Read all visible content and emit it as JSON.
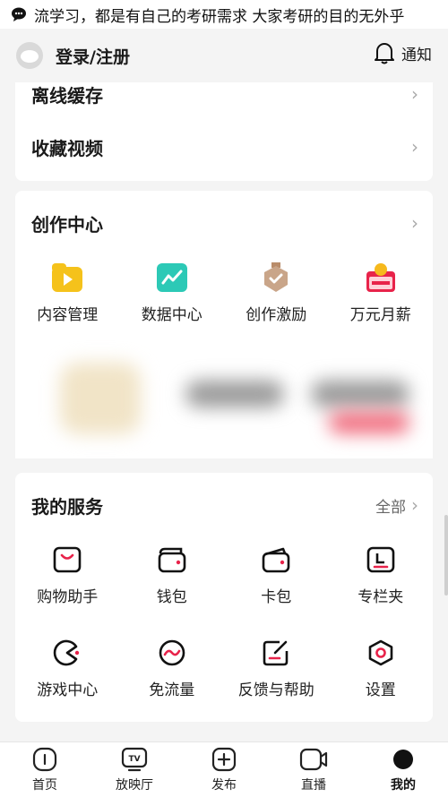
{
  "ticker": {
    "text": "流学习，都是有自己的考研需求 大家考研的目的无外乎"
  },
  "header": {
    "login_label": "登录/注册",
    "notify_label": "通知"
  },
  "top_card": {
    "items": [
      {
        "label": "离线缓存"
      },
      {
        "label": "收藏视频"
      }
    ]
  },
  "creator": {
    "title": "创作中心",
    "items": [
      {
        "label": "内容管理",
        "icon": "video-folder-icon"
      },
      {
        "label": "数据中心",
        "icon": "chart-line-icon"
      },
      {
        "label": "创作激励",
        "icon": "medal-icon"
      },
      {
        "label": "万元月薪",
        "icon": "calendar-coin-icon"
      }
    ]
  },
  "services": {
    "title": "我的服务",
    "all_label": "全部",
    "items": [
      {
        "label": "购物助手",
        "icon": "shopping-bag-icon"
      },
      {
        "label": "钱包",
        "icon": "wallet-icon"
      },
      {
        "label": "卡包",
        "icon": "card-holder-icon"
      },
      {
        "label": "专栏夹",
        "icon": "column-folder-icon"
      },
      {
        "label": "游戏中心",
        "icon": "game-pacman-icon"
      },
      {
        "label": "免流量",
        "icon": "free-data-icon"
      },
      {
        "label": "反馈与帮助",
        "icon": "feedback-edit-icon"
      },
      {
        "label": "设置",
        "icon": "settings-hexagon-icon"
      }
    ]
  },
  "tabbar": {
    "items": [
      {
        "label": "首页",
        "icon": "home-icon"
      },
      {
        "label": "放映厅",
        "icon": "tv-icon"
      },
      {
        "label": "发布",
        "icon": "publish-plus-icon"
      },
      {
        "label": "直播",
        "icon": "live-camera-icon"
      },
      {
        "label": "我的",
        "icon": "profile-dot-icon"
      }
    ]
  },
  "colors": {
    "accent_red": "#e8234a",
    "background": "#f4f4f4",
    "card": "#ffffff"
  }
}
